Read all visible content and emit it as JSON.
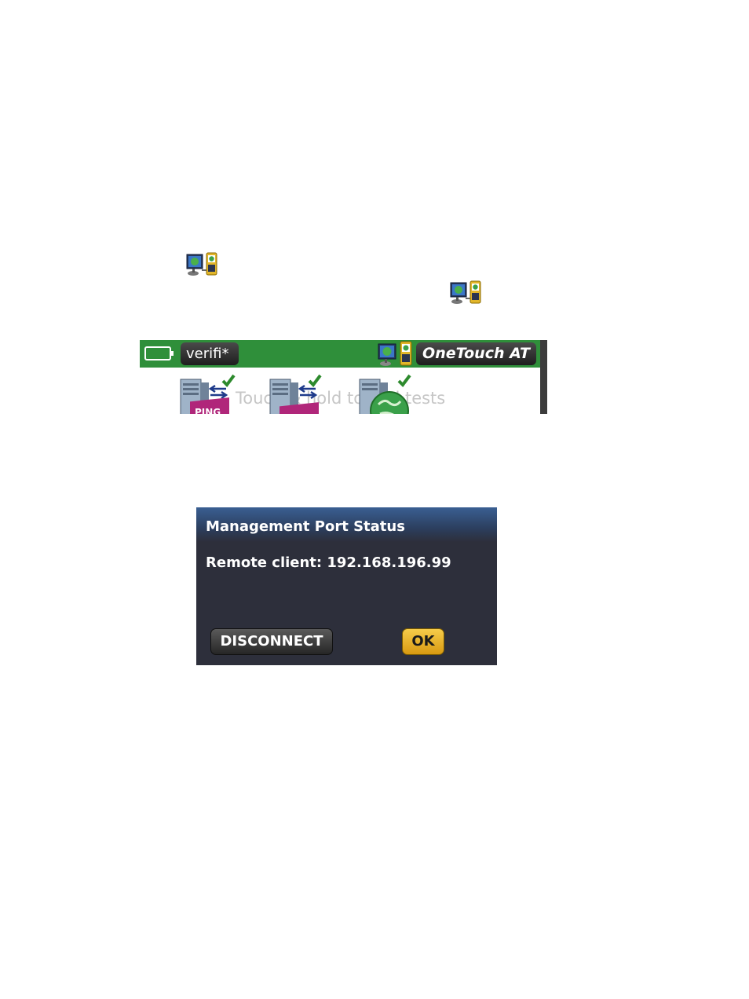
{
  "status_bar": {
    "profile_label": "verifi*",
    "model_label": "OneTouch AT",
    "background_color": "#2f8f3a"
  },
  "tests_area": {
    "hint": "Touch & hold to add tests",
    "tests": [
      {
        "icon": "ping-test-icon",
        "badge": "PING"
      },
      {
        "icon": "connect-test-icon",
        "badge": ""
      },
      {
        "icon": "web-test-icon",
        "badge": ""
      }
    ]
  },
  "dialog": {
    "title": "Management Port Status",
    "message": "Remote client: 192.168.196.99",
    "disconnect_label": "DISCONNECT",
    "ok_label": "OK",
    "accent_color": "#e8b52c"
  },
  "icons": {
    "remote_connection": "remote-connection-icon",
    "battery": "battery-icon",
    "check": "checkmark-icon"
  }
}
